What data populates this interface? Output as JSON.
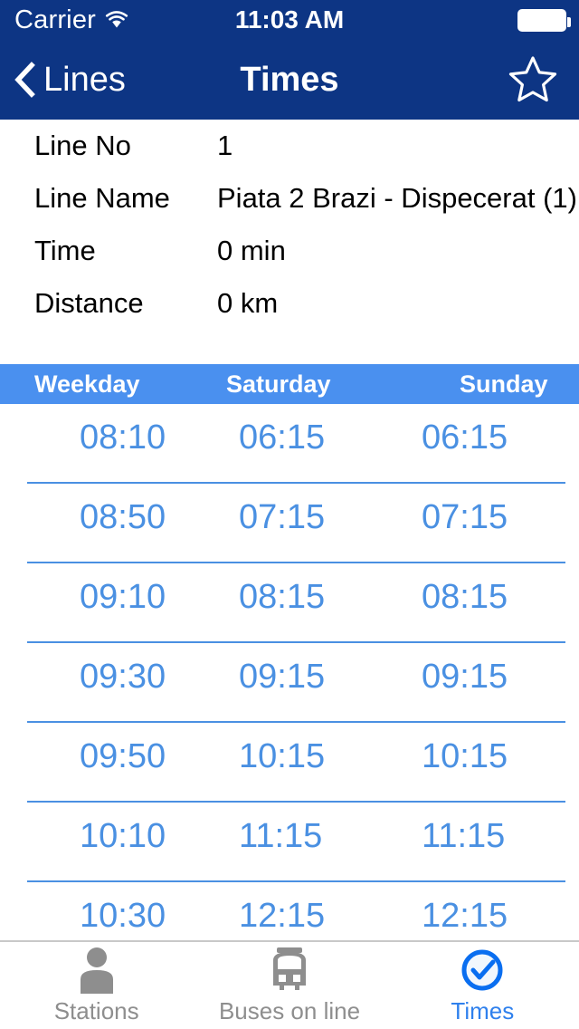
{
  "status_bar": {
    "carrier": "Carrier",
    "wifi_icon": "wifi-icon",
    "time": "11:03 AM",
    "battery_icon": "battery-full-icon"
  },
  "nav_bar": {
    "back_label": "Lines",
    "back_icon": "chevron-left-icon",
    "title": "Times",
    "favorite_icon": "star-outline-icon"
  },
  "details": [
    {
      "label": "Line No",
      "value": "1"
    },
    {
      "label": "Line Name",
      "value": "Piata 2 Brazi - Dispecerat (1)"
    },
    {
      "label": "Time",
      "value": "0 min"
    },
    {
      "label": "Distance",
      "value": "0 km"
    }
  ],
  "schedule": {
    "columns": [
      "Weekday",
      "Saturday",
      "Sunday"
    ],
    "rows": [
      [
        "08:10",
        "06:15",
        "06:15"
      ],
      [
        "08:50",
        "07:15",
        "07:15"
      ],
      [
        "09:10",
        "08:15",
        "08:15"
      ],
      [
        "09:30",
        "09:15",
        "09:15"
      ],
      [
        "09:50",
        "10:15",
        "10:15"
      ],
      [
        "10:10",
        "11:15",
        "11:15"
      ],
      [
        "10:30",
        "12:15",
        "12:15"
      ]
    ]
  },
  "tab_bar": {
    "items": [
      {
        "label": "Stations",
        "icon": "person-icon",
        "active": false
      },
      {
        "label": "Buses on line",
        "icon": "bus-icon",
        "active": false
      },
      {
        "label": "Times",
        "icon": "clock-check-icon",
        "active": true
      }
    ]
  },
  "colors": {
    "navbar": "#0d3584",
    "table_header": "#4a90ef",
    "time_text": "#4a90e2",
    "tab_inactive": "#8e8e8e",
    "tab_active": "#2f80ed"
  }
}
